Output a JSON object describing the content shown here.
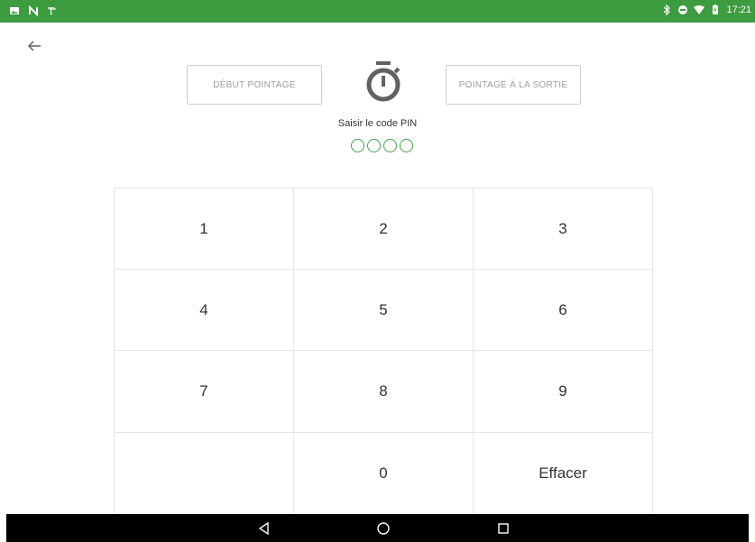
{
  "status_bar": {
    "time": "17:21",
    "left_icons": [
      "image-icon",
      "n-app-icon",
      "nyt-icon"
    ],
    "right_icons": [
      "bluetooth-icon",
      "dnd-icon",
      "wifi-icon",
      "battery-icon"
    ],
    "color": "#3d9b40"
  },
  "header": {
    "back_icon": "arrow-left-icon"
  },
  "actions": {
    "start_label": "DÉBUT POINTAGE",
    "end_label": "POINTAGE À LA SORTIE",
    "timer_icon": "stopwatch-icon"
  },
  "pin": {
    "prompt": "Saisir le code PIN",
    "length": 4,
    "entered": 0,
    "accent": "#46a04a"
  },
  "keypad": {
    "keys": [
      "1",
      "2",
      "3",
      "4",
      "5",
      "6",
      "7",
      "8",
      "9",
      "",
      "0",
      "Effacer"
    ]
  },
  "nav_bar": {
    "icons": [
      "back-triangle-icon",
      "home-circle-icon",
      "recents-square-icon"
    ]
  }
}
